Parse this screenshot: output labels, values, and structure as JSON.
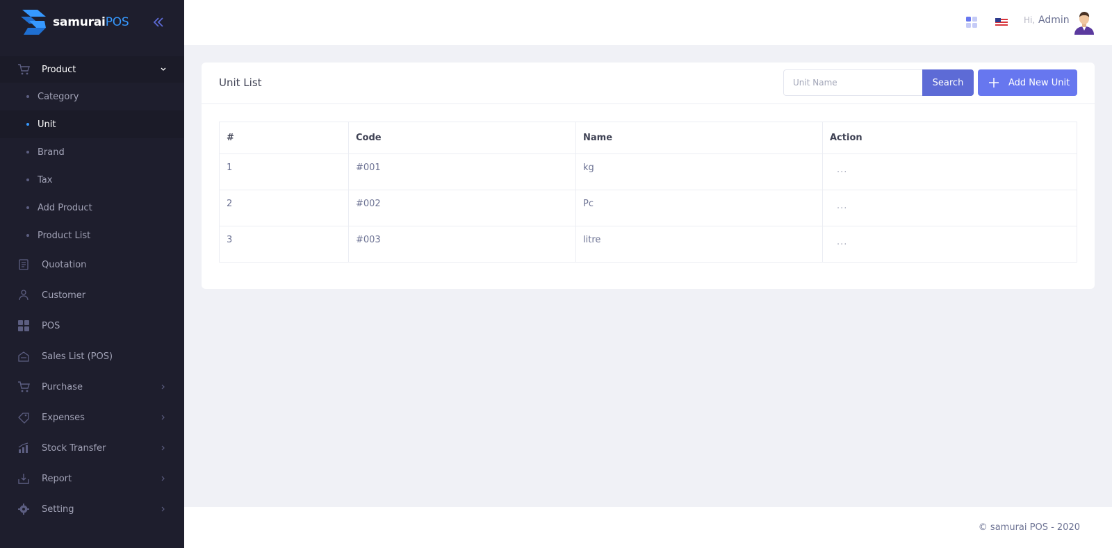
{
  "brand": {
    "name_main": "samurai",
    "name_accent": "POS"
  },
  "sidebar": {
    "product": {
      "label": "Product",
      "icon": "cart-icon"
    },
    "product_submenu": [
      {
        "label": "Category"
      },
      {
        "label": "Unit",
        "active": true
      },
      {
        "label": "Brand"
      },
      {
        "label": "Tax"
      },
      {
        "label": "Add Product"
      },
      {
        "label": "Product List"
      }
    ],
    "items": [
      {
        "label": "Quotation",
        "icon": "quotation-icon"
      },
      {
        "label": "Customer",
        "icon": "customer-icon"
      },
      {
        "label": "POS",
        "icon": "grid-icon"
      },
      {
        "label": "Sales List (POS)",
        "icon": "sales-list-icon"
      },
      {
        "label": "Purchase",
        "icon": "cart-icon"
      },
      {
        "label": "Expenses",
        "icon": "expenses-icon"
      },
      {
        "label": "Stock Transfer",
        "icon": "chart-icon"
      },
      {
        "label": "Report",
        "icon": "report-icon"
      },
      {
        "label": "Setting",
        "icon": "gear-icon"
      }
    ]
  },
  "header": {
    "greeting": "Hi,",
    "user_name": "Admin"
  },
  "card": {
    "title": "Unit List",
    "search_placeholder": "Unit Name",
    "search_label": "Search",
    "add_label": "Add New Unit"
  },
  "table": {
    "columns": [
      "#",
      "Code",
      "Name",
      "Action"
    ],
    "rows": [
      {
        "num": "1",
        "code": "#001",
        "name": "kg",
        "action": "..."
      },
      {
        "num": "2",
        "code": "#002",
        "name": "Pc",
        "action": "..."
      },
      {
        "num": "3",
        "code": "#003",
        "name": "litre",
        "action": "..."
      }
    ]
  },
  "footer": {
    "text": "© samurai POS - 2020"
  },
  "colors": {
    "sidebar_bg": "#1e1e2d",
    "primary": "#6777ef",
    "search_btn": "#5d6bd6",
    "active_bullet": "#3699ff"
  }
}
